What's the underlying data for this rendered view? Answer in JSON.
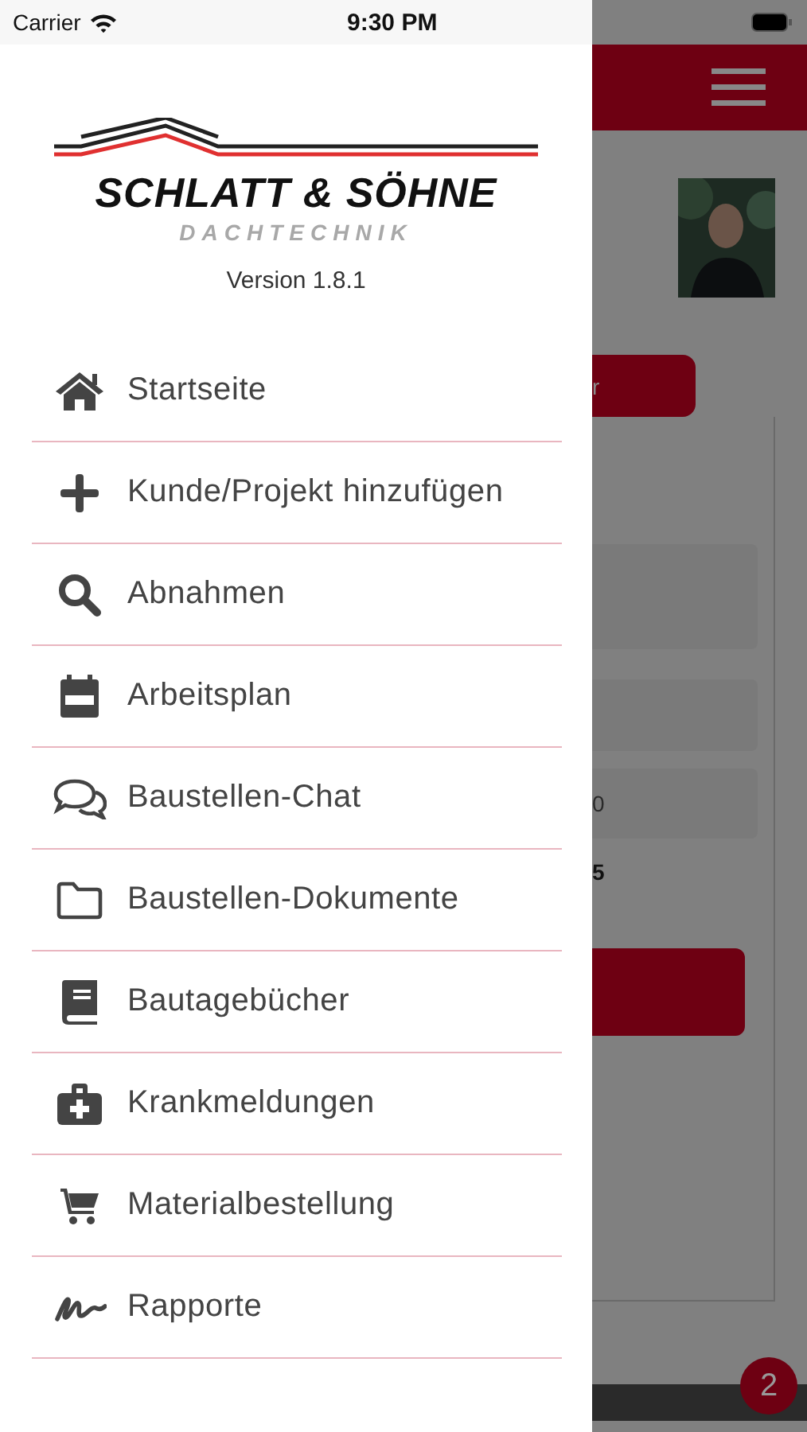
{
  "status_bar": {
    "carrier": "Carrier",
    "time": "9:30 PM"
  },
  "drawer": {
    "logo": {
      "name": "SCHLATT & SÖHNE",
      "tagline": "DACHTECHNIK"
    },
    "version": "Version 1.8.1",
    "items": [
      {
        "label": "Startseite"
      },
      {
        "label": "Kunde/Projekt hinzufügen"
      },
      {
        "label": "Abnahmen"
      },
      {
        "label": "Arbeitsplan"
      },
      {
        "label": "Baustellen-Chat"
      },
      {
        "label": "Baustellen-Dokumente"
      },
      {
        "label": "Bautagebücher"
      },
      {
        "label": "Krankmeldungen"
      },
      {
        "label": "Materialbestellung"
      },
      {
        "label": "Rapporte"
      }
    ]
  },
  "background": {
    "button_fragment": "r",
    "field_fragment": "0",
    "text_fragment": "5",
    "badge": "2"
  }
}
